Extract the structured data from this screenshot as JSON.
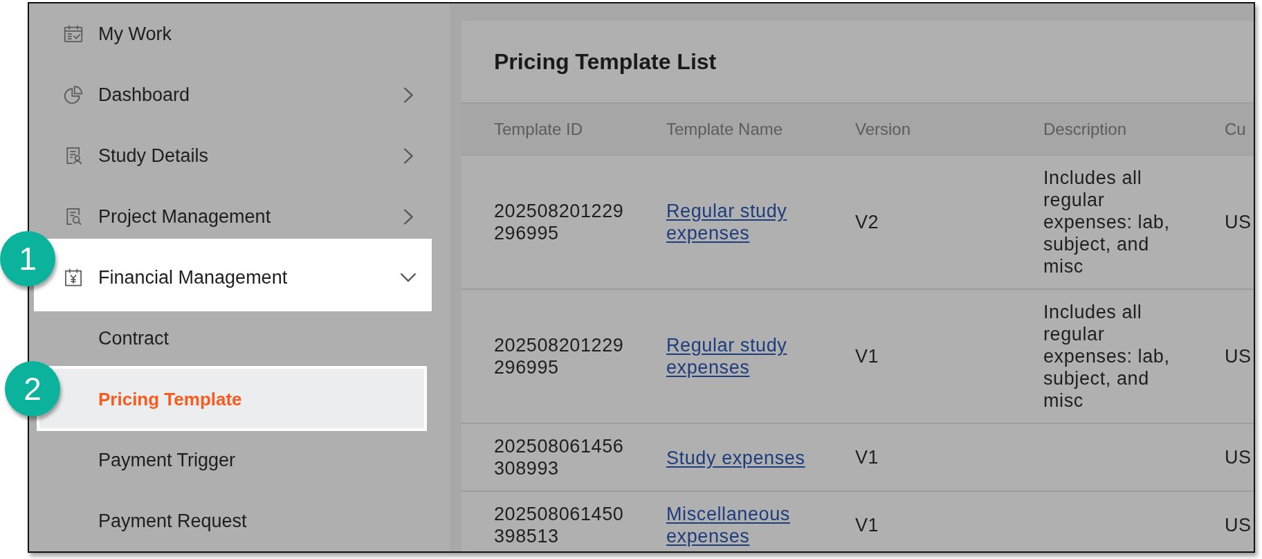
{
  "sidebar": {
    "items": [
      {
        "kind": "link",
        "label": "My Work",
        "selected": false,
        "highlighted": false
      },
      {
        "kind": "group",
        "label": "Dashboard",
        "expanded": false,
        "selected": false,
        "highlighted": false
      },
      {
        "kind": "group",
        "label": "Study Details",
        "expanded": false,
        "selected": false,
        "highlighted": false
      },
      {
        "kind": "group",
        "label": "Project Management",
        "expanded": false,
        "selected": false,
        "highlighted": false
      },
      {
        "kind": "group",
        "label": "Financial Management",
        "expanded": true,
        "selected": false,
        "highlighted": true,
        "step": "1",
        "children": [
          {
            "label": "Contract",
            "selected": false,
            "highlighted": false
          },
          {
            "label": "Pricing Template",
            "selected": true,
            "highlighted": true,
            "step": "2"
          },
          {
            "label": "Payment Trigger",
            "selected": false,
            "highlighted": false
          },
          {
            "label": "Payment Request",
            "selected": false,
            "highlighted": false
          }
        ]
      }
    ]
  },
  "page": {
    "title": "Pricing Template List"
  },
  "table": {
    "columns": [
      "Template ID",
      "Template Name",
      "Version",
      "Description",
      "Cu"
    ],
    "rows": [
      {
        "template_id": "202508201229296995",
        "template_name": "Regular study expenses",
        "version": "V2",
        "description": "Includes all regular expenses: lab, subject, and misc",
        "column_5": "US"
      },
      {
        "template_id": "202508201229296995",
        "template_name": "Regular study expenses",
        "version": "V1",
        "description": "Includes all regular expenses: lab, subject, and misc",
        "column_5": "US"
      },
      {
        "template_id": "202508061456308993",
        "template_name": "Study expenses",
        "version": "V1",
        "column_5": "US"
      },
      {
        "template_id": "202508061450398513",
        "template_name": "Miscellaneous expenses",
        "version": "V1",
        "column_5": "US"
      }
    ]
  }
}
